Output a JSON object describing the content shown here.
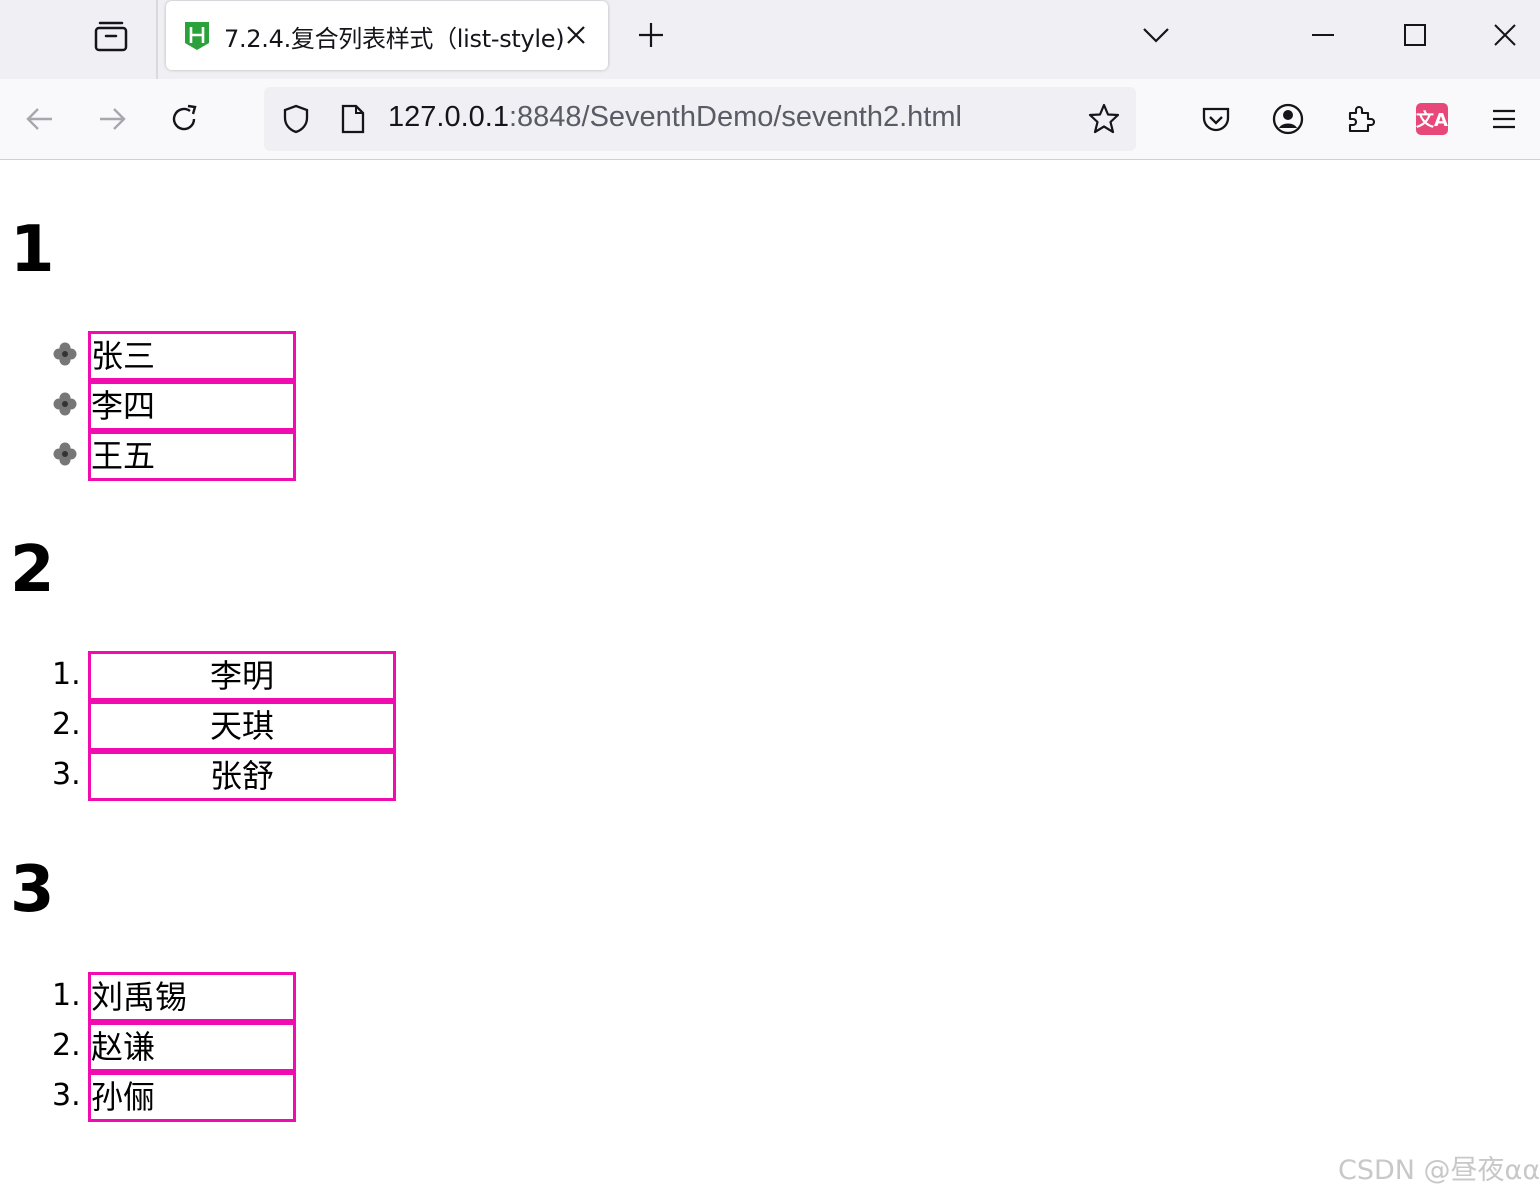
{
  "browser": {
    "tab": {
      "title": "7.2.4.复合列表样式（list-style)",
      "favicon": "hbuilder-h-icon"
    },
    "url": {
      "host": "127.0.0.1",
      "rest": ":8848/SeventhDemo/seventh2.html"
    },
    "colors": {
      "tabstrip": "#f0f0f4",
      "toolbar": "#f9f9fb",
      "translate": "#e8477a",
      "favicon": "#2aa13a"
    },
    "translate_badge": "文A"
  },
  "page": {
    "sections": [
      {
        "heading": "1",
        "items": [
          "张三",
          "李四",
          "王五"
        ],
        "marker": "clover-image-icon"
      },
      {
        "heading": "2",
        "items": [
          "李明",
          "天琪",
          "张舒"
        ],
        "markers": [
          "1.",
          "2.",
          "3."
        ]
      },
      {
        "heading": "3",
        "items": [
          "刘禹锡",
          "赵谦",
          "孙俪"
        ],
        "markers": [
          "1.",
          "2.",
          "3."
        ]
      }
    ],
    "border_color": "#f00cb0"
  },
  "watermark": "CSDN @昼夜αα"
}
